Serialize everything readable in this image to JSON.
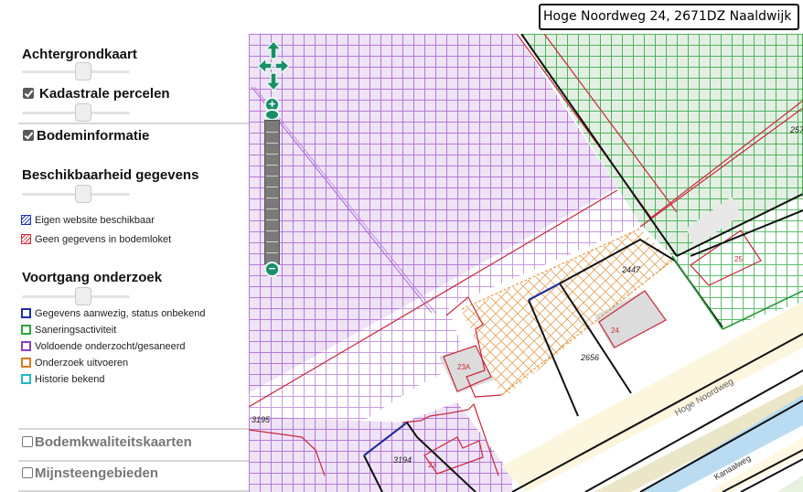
{
  "search": {
    "value": "Hoge Noordweg 24, 2671DZ Naaldwijk"
  },
  "sidebar": {
    "achtergrondkaart": "Achtergrondkaart",
    "kadastrale": "Kadastrale percelen",
    "bodeminformatie": "Bodeminformatie",
    "beschikbaarheid": "Beschikbaarheid gegevens",
    "beschikbaarheid_items": [
      {
        "label": "Eigen website beschikbaar",
        "color": "#1f2fb3"
      },
      {
        "label": "Geen gegevens in bodemloket",
        "color": "#d42a3a"
      }
    ],
    "voortgang": "Voortgang onderzoek",
    "voortgang_items": [
      {
        "label": "Gegevens aanwezig, status onbekend",
        "color": "#1e2ea6"
      },
      {
        "label": "Saneringsactiviteit",
        "color": "#2aa640"
      },
      {
        "label": "Voldoende onderzocht/gesaneerd",
        "color": "#8a3ec8"
      },
      {
        "label": "Onderzoek uitvoeren",
        "color": "#d97a1c"
      },
      {
        "label": "Historie bekend",
        "color": "#27b6c6"
      }
    ],
    "bodemkwaliteit": "Bodemkwaliteitskaarten",
    "mijnsteen": "Mijnsteengebieden"
  },
  "map": {
    "parcels": [
      "2447",
      "2656",
      "3195",
      "3194",
      "257"
    ],
    "buildings": [
      "24",
      "25",
      "23A",
      "23"
    ],
    "streets": [
      "Hoge Noordweg",
      "Kanaalweg"
    ]
  },
  "controls": {
    "zoom_in": "+",
    "zoom_out": "−"
  }
}
